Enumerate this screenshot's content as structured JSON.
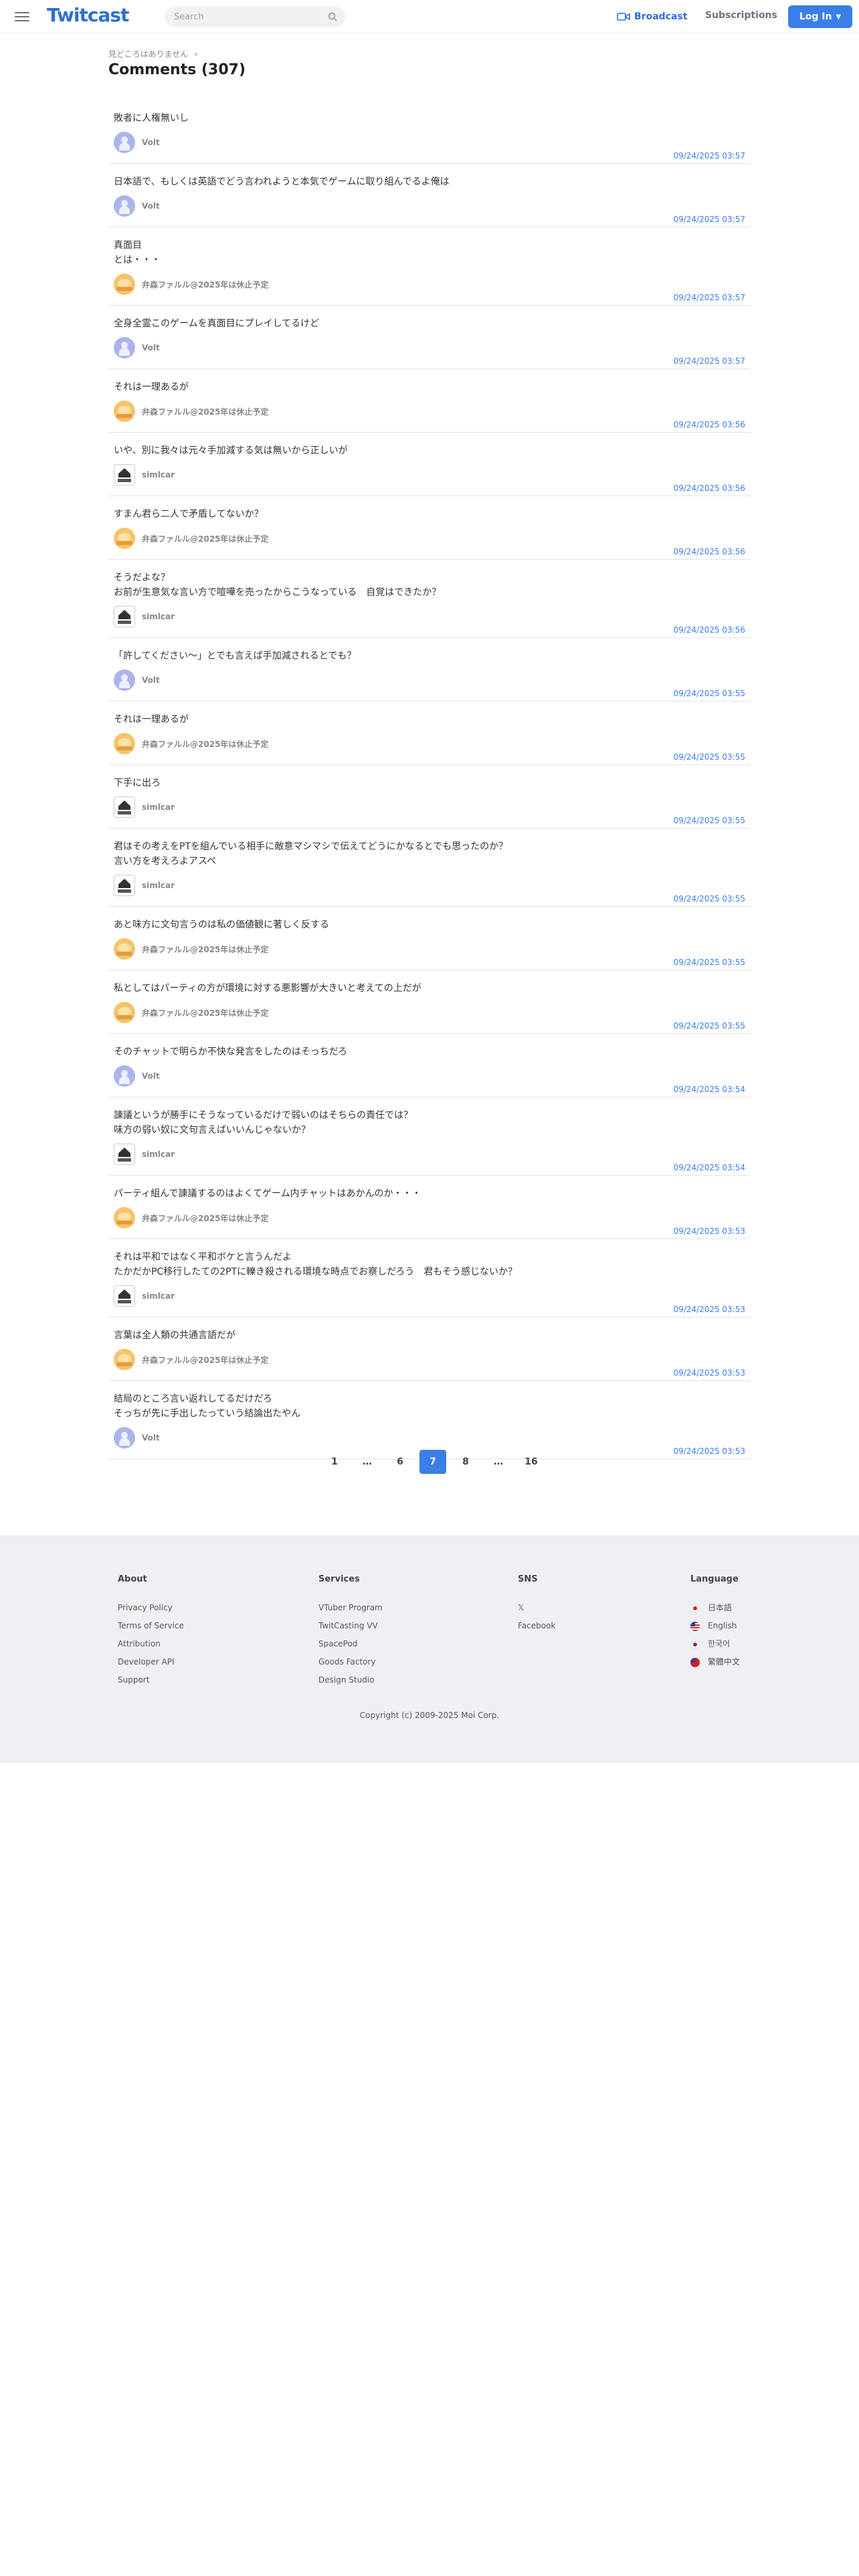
{
  "header": {
    "logo": "Twitcast",
    "search_placeholder": "Search",
    "broadcast_label": "Broadcast",
    "subscriptions_label": "Subscriptions",
    "login_label": "Log In",
    "accent_color": "#3a7ee8"
  },
  "breadcrumb": {
    "item": "見どころはありません",
    "separator": "»"
  },
  "page_title": "Comments (307)",
  "comments": [
    {
      "text": "敗者に人権無いし",
      "author": "Volt",
      "avatar": "volt",
      "date": "09/24/2025 03:57"
    },
    {
      "text": "日本語で、もしくは英語でどう言われようと本気でゲームに取り組んでるよ俺は",
      "author": "Volt",
      "avatar": "volt",
      "date": "09/24/2025 03:57"
    },
    {
      "text": "真面目\nとは・・・",
      "author": "弁森ファルル@2025年は休止予定",
      "avatar": "fire",
      "date": "09/24/2025 03:57"
    },
    {
      "text": "全身全霊このゲームを真面目にプレイしてるけど",
      "author": "Volt",
      "avatar": "volt",
      "date": "09/24/2025 03:57"
    },
    {
      "text": "それは一理あるが",
      "author": "弁森ファルル@2025年は休止予定",
      "avatar": "fire",
      "date": "09/24/2025 03:56"
    },
    {
      "text": "いや、別に我々は元々手加減する気は無いから正しいが",
      "author": "simlcar",
      "avatar": "sim",
      "date": "09/24/2025 03:56"
    },
    {
      "text": "すまん君ら二人で矛盾してないか？",
      "author": "弁森ファルル@2025年は休止予定",
      "avatar": "fire",
      "date": "09/24/2025 03:56"
    },
    {
      "text": "そうだよな？\nお前が生意気な言い方で喧嘩を売ったからこうなっている　自覚はできたか？",
      "author": "simlcar",
      "avatar": "sim",
      "date": "09/24/2025 03:56"
    },
    {
      "text": "「許してください〜」とでも言えば手加減されるとでも？",
      "author": "Volt",
      "avatar": "volt",
      "date": "09/24/2025 03:55"
    },
    {
      "text": "それは一理あるが",
      "author": "弁森ファルル@2025年は休止予定",
      "avatar": "fire",
      "date": "09/24/2025 03:55"
    },
    {
      "text": "下手に出ろ",
      "author": "simlcar",
      "avatar": "sim",
      "date": "09/24/2025 03:55"
    },
    {
      "text": "君はその考えをPTを組んでいる相手に敵意マシマシで伝えてどうにかなるとでも思ったのか？\n言い方を考えろよアスペ",
      "author": "simlcar",
      "avatar": "sim",
      "date": "09/24/2025 03:55"
    },
    {
      "text": "あと味方に文句言うのは私の価値観に著しく反する",
      "author": "弁森ファルル@2025年は休止予定",
      "avatar": "fire",
      "date": "09/24/2025 03:55"
    },
    {
      "text": "私としてはパーティの方が環境に対する悪影響が大きいと考えての上だが",
      "author": "弁森ファルル@2025年は休止予定",
      "avatar": "fire",
      "date": "09/24/2025 03:55"
    },
    {
      "text": "そのチャットで明らか不快な発言をしたのはそっちだろ",
      "author": "Volt",
      "avatar": "volt",
      "date": "09/24/2025 03:54"
    },
    {
      "text": "諌議というが勝手にそうなっているだけで弱いのはそちらの責任では？\n味方の弱い奴に文句言えばいいんじゃないか？",
      "author": "simlcar",
      "avatar": "sim",
      "date": "09/24/2025 03:54"
    },
    {
      "text": "パーティ組んで諌議するのはよくてゲーム内チャットはあかんのか・・・",
      "author": "弁森ファルル@2025年は休止予定",
      "avatar": "fire",
      "date": "09/24/2025 03:53"
    },
    {
      "text": "それは平和ではなく平和ボケと言うんだよ\nたかだかPC移行したての2PTに轢き殺される環境な時点でお察しだろう　君もそう感じないか？",
      "author": "simlcar",
      "avatar": "sim",
      "date": "09/24/2025 03:53"
    },
    {
      "text": "言葉は全人類の共通言語だが",
      "author": "弁森ファルル@2025年は休止予定",
      "avatar": "fire",
      "date": "09/24/2025 03:53"
    },
    {
      "text": "結局のところ言い返れしてるだけだろ\nそっちが先に手出したっていう結論出たやん",
      "author": "Volt",
      "avatar": "volt",
      "date": "09/24/2025 03:53"
    }
  ],
  "pagination": {
    "pages": [
      "1",
      "…",
      "6",
      "7",
      "8",
      "…",
      "16"
    ],
    "current": "7"
  },
  "footer": {
    "about": {
      "title": "About",
      "links": [
        "Privacy Policy",
        "Terms of Service",
        "Attribution",
        "Developer API",
        "Support"
      ]
    },
    "services": {
      "title": "Services",
      "links": [
        "VTuber Program",
        "TwitCasting VV",
        "SpacePod",
        "Goods Factory",
        "Design Studio"
      ]
    },
    "sns": {
      "title": "SNS",
      "links": [
        "𝕏",
        "Facebook"
      ]
    },
    "language": {
      "title": "Language",
      "items": [
        {
          "label": "日本語",
          "flag": "jp"
        },
        {
          "label": "English",
          "flag": "us"
        },
        {
          "label": "한국어",
          "flag": "kr"
        },
        {
          "label": "繁體中文",
          "flag": "tw"
        }
      ]
    },
    "copyright": "Copyright (c) 2009-2025 Moi Corp."
  }
}
